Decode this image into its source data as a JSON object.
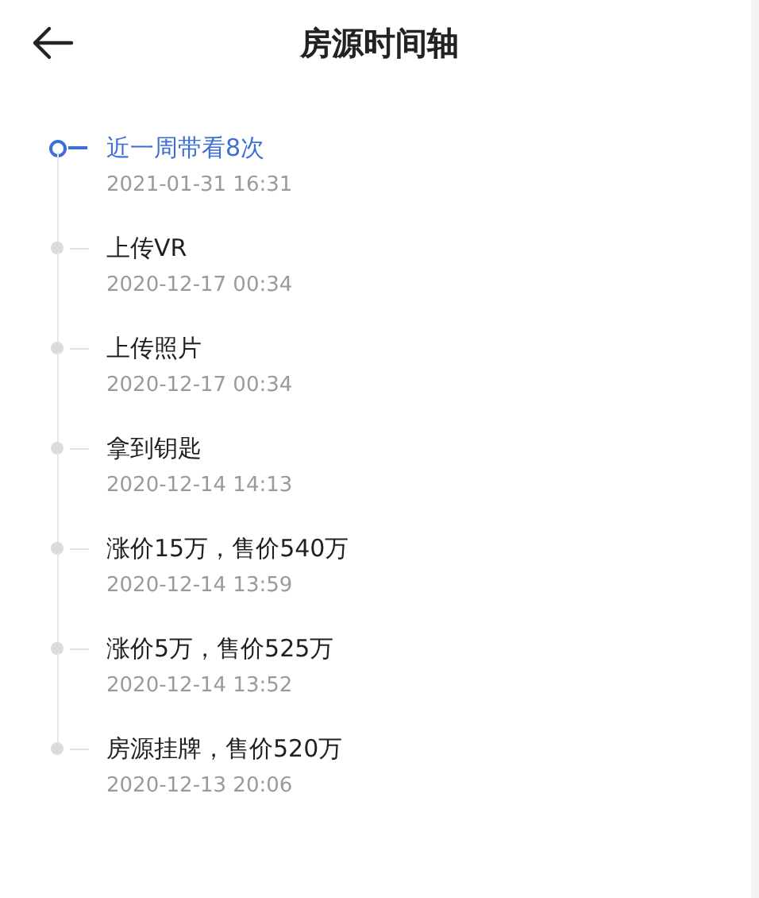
{
  "header": {
    "title": "房源时间轴"
  },
  "events": [
    {
      "title": "近一周带看8次",
      "time": "2021-01-31 16:31",
      "selected": true
    },
    {
      "title": "上传VR",
      "time": "2020-12-17 00:34",
      "selected": false
    },
    {
      "title": "上传照片",
      "time": "2020-12-17 00:34",
      "selected": false
    },
    {
      "title": "拿到钥匙",
      "time": "2020-12-14 14:13",
      "selected": false
    },
    {
      "title": "涨价15万，售价540万",
      "time": "2020-12-14 13:59",
      "selected": false
    },
    {
      "title": "涨价5万，售价525万",
      "time": "2020-12-14 13:52",
      "selected": false
    },
    {
      "title": "房源挂牌，售价520万",
      "time": "2020-12-13 20:06",
      "selected": false
    }
  ]
}
